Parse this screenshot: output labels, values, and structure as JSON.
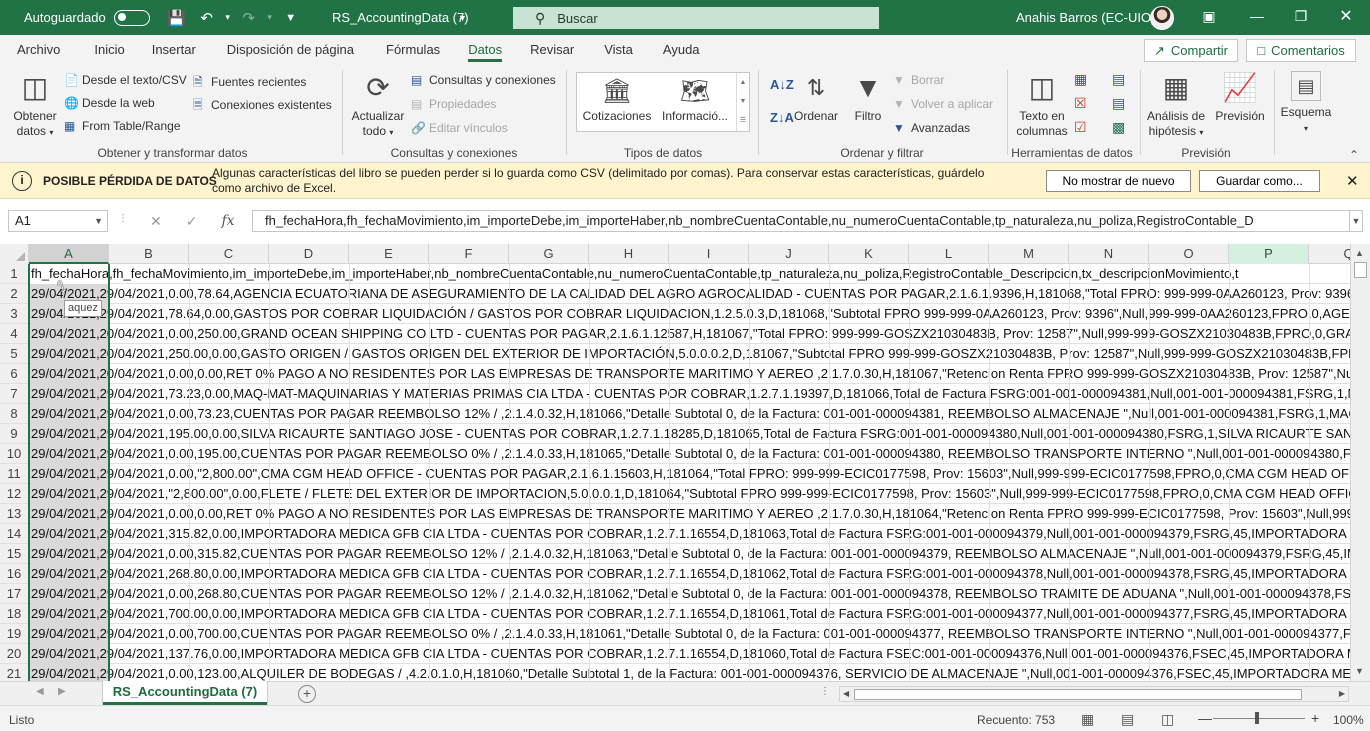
{
  "titlebar": {
    "autosave_label": "Autoguardado",
    "doc_title": "RS_AccountingData (7)",
    "search_placeholder": "Buscar",
    "user_name": "Anahis Barros (EC-UIO)"
  },
  "tabs": [
    "Archivo",
    "Inicio",
    "Insertar",
    "Disposición de página",
    "Fórmulas",
    "Datos",
    "Revisar",
    "Vista",
    "Ayuda"
  ],
  "active_tab": "Datos",
  "share_label": "Compartir",
  "comments_label": "Comentarios",
  "ribbon": {
    "get_data": "Obtener datos",
    "from_text": "Desde el texto/CSV",
    "from_web": "Desde la web",
    "from_table": "From Table/Range",
    "recent_sources": "Fuentes recientes",
    "existing_connections": "Conexiones existentes",
    "group_get_transform": "Obtener y transformar datos",
    "refresh_all": "Actualizar todo",
    "queries_connections": "Consultas y conexiones",
    "properties": "Propiedades",
    "edit_links": "Editar vínculos",
    "group_queries": "Consultas y conexiones",
    "stocks": "Cotizaciones",
    "geography": "Informació...",
    "group_data_types": "Tipos de datos",
    "sort": "Ordenar",
    "filter": "Filtro",
    "clear": "Borrar",
    "reapply": "Volver a aplicar",
    "advanced": "Avanzadas",
    "group_sort_filter": "Ordenar y filtrar",
    "text_to_columns": "Texto en columnas",
    "group_data_tools": "Herramientas de datos",
    "what_if": "Análisis de hipótesis",
    "forecast": "Previsión",
    "group_forecast": "Previsión",
    "outline": "Esquema"
  },
  "message_bar": {
    "title": "POSIBLE PÉRDIDA DE DATOS",
    "text": "Algunas características del libro se pueden perder si lo guarda como CSV (delimitado por comas). Para conservar estas características, guárdelo como archivo de Excel.",
    "btn_dont_show": "No mostrar de nuevo",
    "btn_save_as": "Guardar como..."
  },
  "formula_bar": {
    "name_box": "A1",
    "fx": "fx",
    "formula": "fh_fechaHora,fh_fechaMovimiento,im_importeDebe,im_importeHaber,nb_nombreCuentaContable,nu_numeroCuentaContable,tp_naturaleza,nu_poliza,RegistroContable_D"
  },
  "columns": [
    "A",
    "B",
    "C",
    "D",
    "E",
    "F",
    "G",
    "H",
    "I",
    "J",
    "K",
    "L",
    "M",
    "N",
    "O",
    "P",
    "Q"
  ],
  "tooltip": "aquez",
  "rows": [
    {
      "n": "1",
      "a": "fh_fechaHora",
      "rest": ",fh_fechaMovimiento,im_importeDebe,im_importeHaber,nb_nombreCuentaContable,nu_numeroCuentaContable,tp_naturaleza,nu_poliza,RegistroContable_Descripcion,tx_descripcionMovimiento,t"
    },
    {
      "n": "2",
      "a": "29/04/2021,2",
      "rest": "9/04/2021,0.00,78.64,AGENCIA ECUATORIANA DE ASEGURAMIENTO DE LA CALIDAD DEL AGRO AGROCALIDAD - CUENTAS POR PAGAR,2.1.6.1.9396,H,181068,\"Total FPRO: 999-999-0AA260123, Prov: 9396\",Nu"
    },
    {
      "n": "3",
      "a": "29/04/2021,2",
      "rest": "9/04/2021,78.64,0.00,GASTOS POR COBRAR LIQUIDACIÓN / GASTOS POR COBRAR LIQUIDACION,1.2.5.0.3,D,181068,\"Subtotal FPRO 999-999-0AA260123, Prov: 9396\",Null,999-999-0AA260123,FPRO,0,AGENC"
    },
    {
      "n": "4",
      "a": "29/04/2021,2",
      "rest": "0/04/2021,0.00,250.00,GRAND OCEAN SHIPPING CO LTD - CUENTAS POR PAGAR,2.1.6.1.12587,H,181067,\"Total FPRO: 999-999-GOSZX21030483B, Prov: 12587\",Null,999-999-GOSZX21030483B,FPRO,0,GRAND"
    },
    {
      "n": "5",
      "a": "29/04/2021,2",
      "rest": "0/04/2021,250.00,0.00,GASTO ORIGEN / GASTOS ORIGEN DEL EXTERIOR DE IMPORTACIÓN,5.0.0.0.2,D,181067,\"Subtotal FPRO 999-999-GOSZX21030483B, Prov: 12587\",Null,999-999-GOSZX21030483B,FPRO,0,"
    },
    {
      "n": "6",
      "a": "29/04/2021,2",
      "rest": "0/04/2021,0.00,0.00,RET 0%  PAGO A NO RESIDENTES POR LAS EMPRESAS DE TRANSPORTE MARITIMO Y AEREO ,2.1.7.0.30,H,181067,\"Retencion Renta FPRO 999-999-GOSZX21030483B, Prov: 12587\",Null,999"
    },
    {
      "n": "7",
      "a": "29/04/2021,2",
      "rest": "9/04/2021,73.23,0.00,MAQ-MAT-MAQUINARIAS Y MATERIAS PRIMAS CIA LTDA - CUENTAS POR COBRAR,1.2.7.1.19397,D,181066,Total de Factura FSRG:001-001-000094381,Null,001-001-000094381,FSRG,1,MA"
    },
    {
      "n": "8",
      "a": "29/04/2021,2",
      "rest": "9/04/2021,0.00,73.23,CUENTAS POR PAGAR REEMBOLSO 12% / ,2.1.4.0.32,H,181066,\"Detalle Subtotal 0, de la Factura: 001-001-000094381, REEMBOLSO ALMACENAJE  \",Null,001-001-000094381,FSRG,1,MAQ"
    },
    {
      "n": "9",
      "a": "29/04/2021,2",
      "rest": "9/04/2021,195.00,0.00,SILVA RICAURTE SANTIAGO JOSE - CUENTAS POR COBRAR,1.2.7.1.18285,D,181065,Total de Factura FSRG:001-001-000094380,Null,001-001-000094380,FSRG,1,SILVA RICAURTE SANTIAG"
    },
    {
      "n": "10",
      "a": "29/04/2021,2",
      "rest": "9/04/2021,0.00,195.00,CUENTAS POR PAGAR REEMBOLSO 0% / ,2.1.4.0.33,H,181065,\"Detalle Subtotal 0, de la Factura: 001-001-000094380, REEMBOLSO TRANSPORTE INTERNO \",Null,001-001-000094380,FSR"
    },
    {
      "n": "11",
      "a": "29/04/2021,2",
      "rest": "9/04/2021,0.00,\"2,800.00\",CMA CGM HEAD OFFICE - CUENTAS POR PAGAR,2.1.6.1.15603,H,181064,\"Total FPRO: 999-999-ECIC0177598, Prov: 15603\",Null,999-999-ECIC0177598,FPRO,0,CMA CGM HEAD OFFIC"
    },
    {
      "n": "12",
      "a": "29/04/2021,2",
      "rest": "9/04/2021,\"2,800.00\",0.00,FLETE / FLETE DEL EXTERIOR DE IMPORTACION,5.0.0.0.1,D,181064,\"Subtotal FPRO 999-999-ECIC0177598, Prov: 15603\",Null,999-999-ECIC0177598,FPRO,0,CMA CGM HEAD OFFICE,'F"
    },
    {
      "n": "13",
      "a": "29/04/2021,2",
      "rest": "9/04/2021,0.00,0.00,RET 0%  PAGO A NO RESIDENTES POR LAS EMPRESAS DE TRANSPORTE MARITIMO Y AEREO ,2.1.7.0.30,H,181064,\"Retencion Renta FPRO 999-999-ECIC0177598, Prov: 15603\",Null,999-999-"
    },
    {
      "n": "14",
      "a": "29/04/2021,2",
      "rest": "9/04/2021,315.82,0.00,IMPORTADORA MEDICA GFB CIA LTDA - CUENTAS POR COBRAR,1.2.7.1.16554,D,181063,Total de Factura FSRG:001-001-000094379,Null,001-001-000094379,FSRG,45,IMPORTADORA ME"
    },
    {
      "n": "15",
      "a": "29/04/2021,2",
      "rest": "9/04/2021,0.00,315.82,CUENTAS POR PAGAR REEMBOLSO 12% / ,2.1.4.0.32,H,181063,\"Detalle Subtotal 0, de la Factura: 001-001-000094379, REEMBOLSO ALMACENAJE  \",Null,001-001-000094379,FSRG,45,IM"
    },
    {
      "n": "16",
      "a": "29/04/2021,2",
      "rest": "9/04/2021,268.80,0.00,IMPORTADORA MEDICA GFB CIA LTDA - CUENTAS POR COBRAR,1.2.7.1.16554,D,181062,Total de Factura FSRG:001-001-000094378,Null,001-001-000094378,FSRG,45,IMPORTADORA ME"
    },
    {
      "n": "17",
      "a": "29/04/2021,2",
      "rest": "9/04/2021,0.00,268.80,CUENTAS POR PAGAR REEMBOLSO 12% / ,2.1.4.0.32,H,181062,\"Detalle Subtotal 0, de la Factura: 001-001-000094378, REEMBOLSO TRAMITE DE ADUANA \",Null,001-001-000094378,FSR"
    },
    {
      "n": "18",
      "a": "29/04/2021,2",
      "rest": "9/04/2021,700.00,0.00,IMPORTADORA MEDICA GFB CIA LTDA - CUENTAS POR COBRAR,1.2.7.1.16554,D,181061,Total de Factura FSRG:001-001-000094377,Null,001-001-000094377,FSRG,45,IMPORTADORA ME"
    },
    {
      "n": "19",
      "a": "29/04/2021,2",
      "rest": "9/04/2021,0.00,700.00,CUENTAS POR PAGAR REEMBOLSO 0% / ,2.1.4.0.33,H,181061,\"Detalle Subtotal 0, de la Factura: 001-001-000094377, REEMBOLSO TRANSPORTE INTERNO \",Null,001-001-000094377,FSR"
    },
    {
      "n": "20",
      "a": "29/04/2021,2",
      "rest": "9/04/2021,137.76,0.00,IMPORTADORA MEDICA GFB CIA LTDA - CUENTAS POR COBRAR,1.2.7.1.16554,D,181060,Total de Factura FSEC:001-001-000094376,Null,001-001-000094376,FSEC,45,IMPORTADORA ME"
    },
    {
      "n": "21",
      "a": "29/04/2021,2",
      "rest": "9/04/2021,0.00,123.00,ALQUILER DE BODEGAS  / ,4.2.0.1.0,H,181060,\"Detalle Subtotal 1, de la Factura: 001-001-000094376, SERVICIO DE ALMACENAJE \",Null,001-001-000094376,FSEC,45,IMPORTADORA ME"
    }
  ],
  "sheet_tab": "RS_AccountingData (7)",
  "status": {
    "ready": "Listo",
    "count": "Recuento: 753",
    "zoom": "100%",
    "zoom_level_percent": 100
  },
  "colors": {
    "excel_green": "#217346",
    "message_bar_bg": "#fff4ce"
  }
}
